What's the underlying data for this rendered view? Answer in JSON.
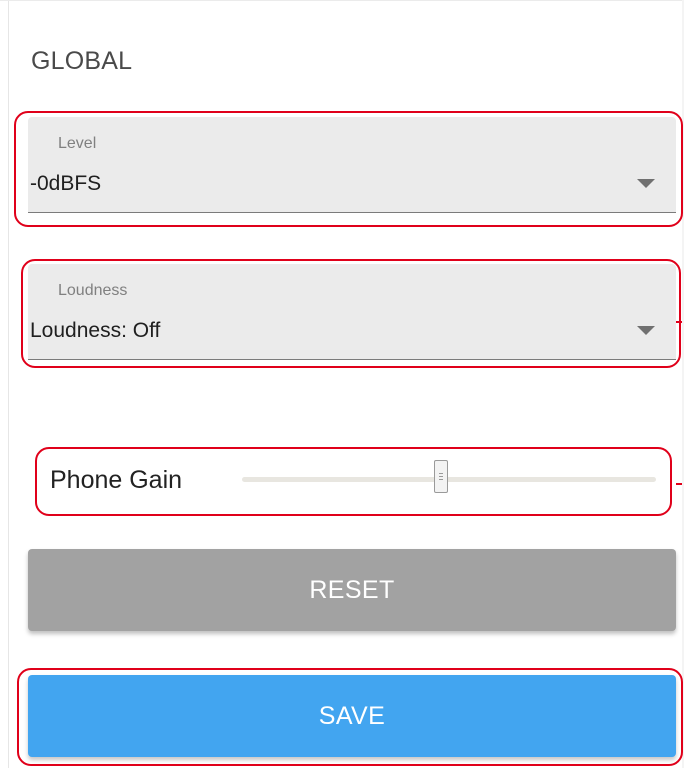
{
  "section": {
    "title": "GLOBAL"
  },
  "level": {
    "label": "Level",
    "value": "-0dBFS"
  },
  "loudness": {
    "label": "Loudness",
    "value": "Loudness: Off"
  },
  "phone_gain": {
    "label": "Phone Gain",
    "slider_fraction": 0.48
  },
  "buttons": {
    "reset_label": "RESET",
    "save_label": "SAVE"
  },
  "colors": {
    "highlight": "#e0001a",
    "save": "#42a5f0",
    "reset": "#a2a2a2"
  }
}
